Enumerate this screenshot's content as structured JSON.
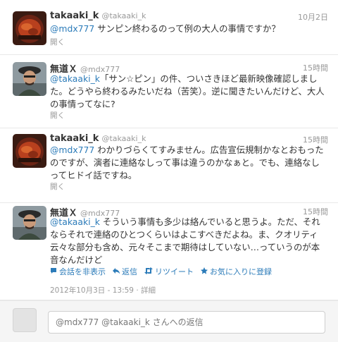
{
  "tweets": [
    {
      "name": "takaaki_k",
      "handle": "@takaaki_k",
      "time": "10月2日",
      "mention": "@mdx777",
      "text": " サンピン終わるのって例の大人の事情ですか？",
      "expand": "開く"
    },
    {
      "name": "無道Ｘ",
      "handle": "@mdx777",
      "time": "15時間",
      "mention": "@takaaki_k",
      "text": "「サン☆ピン」の件、ついさきほど最新映像確認しました。どうやら終わるみたいだね（苦笑）。逆に聞きたいんだけど、大人の事情ってなに?",
      "expand": "開く"
    },
    {
      "name": "takaaki_k",
      "handle": "@takaaki_k",
      "time": "15時間",
      "mention": "@mdx777",
      "text": " わかりづらくてすみません。広告宣伝規制かなとおもったのですが、演者に連絡なしって事は違うのかなぁと。でも、連絡なしってヒドイ話ですね。",
      "expand": "開く"
    },
    {
      "name": "無道Ｘ",
      "handle": "@mdx777",
      "time": "15時間",
      "mention": "@takaaki_k",
      "text": " そういう事情も多少は絡んでいると思うよ。ただ、それならそれで連絡のひとつくらいはよこすべきだよね。ま、クオリティ云々な部分も含め、元々そこまで期待はしていない…っていうのが本音なんだけど",
      "actions": {
        "conversation": "会話を非表示",
        "reply": "返信",
        "retweet": "リツイート",
        "favorite": "お気に入りに登録"
      },
      "timestamp": "2012年10月3日 - 13:59",
      "details": "詳細"
    }
  ],
  "reply_box": {
    "placeholder": "@mdx777 @takaaki_k さんへの返信"
  },
  "icons": {
    "conversation": "speech-bubble-icon",
    "reply": "reply-arrow-icon",
    "retweet": "retweet-icon",
    "favorite": "star-icon"
  },
  "colors": {
    "link": "#2b7bb9",
    "muted": "#999999",
    "text": "#333333"
  }
}
